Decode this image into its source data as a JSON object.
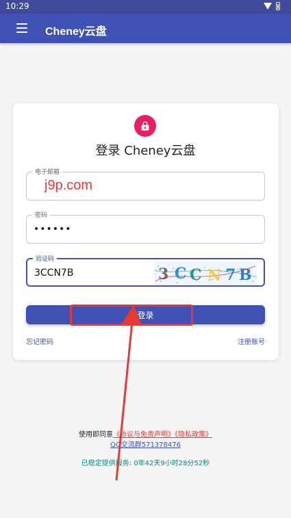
{
  "status_bar": {
    "time": "10:29",
    "icons": [
      "wifi-icon",
      "battery-icon"
    ]
  },
  "app_bar": {
    "title": "Cheney云盘"
  },
  "login_card": {
    "title": "登录 Cheney云盘",
    "email_label": "电子邮箱",
    "email_value": "j9p.com",
    "password_label": "密码",
    "password_value": "••••••",
    "captcha_label": "验证码",
    "captcha_value": "3CCN7B",
    "captcha_image_text": "3CCN7B",
    "login_button": "登录",
    "forgot_password": "忘记密码",
    "register": "注册账号"
  },
  "footer": {
    "agreement_prefix": "使用即同意",
    "agreement_links": "《协议与免责声明》《隐私政策》",
    "qq_group": "QQ交流群571378476",
    "uptime": "已稳定提供服务: 0年42天9小时28分52秒"
  },
  "colors": {
    "primary": "#3f51b5",
    "accent_pink": "#e91e63",
    "highlight_red": "#e53935",
    "teal": "#00897b"
  }
}
